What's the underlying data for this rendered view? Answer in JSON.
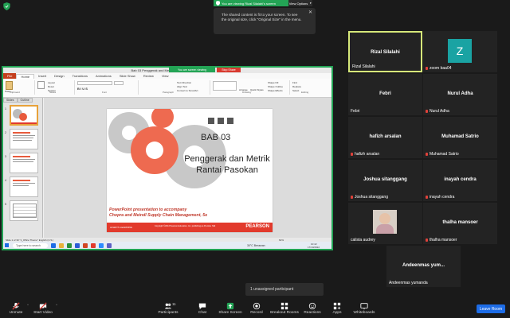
{
  "banner": {
    "text": "You are viewing Rizal Silalahi's screen",
    "view_options": "View Options"
  },
  "tooltip": {
    "text": "The shared content is fit to your screen. To see the original size, click \"Original Size\" in the menu."
  },
  "powerpoint": {
    "title": "Bab 03 Penggerak and Metrik Rantai Pasokan.pptx",
    "viewing": "You are screen viewing",
    "stop": "Stop Share",
    "tabs": [
      "File",
      "Home",
      "Insert",
      "Design",
      "Transitions",
      "Animations",
      "Slide Show",
      "Review",
      "View"
    ],
    "ribbon_groups": [
      "Clipboard",
      "Slides",
      "Font",
      "Paragraph",
      "Drawing",
      "Editing"
    ],
    "ribbon_items": [
      "Paste",
      "Layout",
      "Reset",
      "Section",
      "Find",
      "Replace",
      "Select",
      "Arrange",
      "Quick Styles",
      "Shape Fill",
      "Shape Outline",
      "Shape Effects",
      "Text Direction",
      "Align Text",
      "Convert to SmartArt"
    ],
    "panel_tabs": [
      "Slides",
      "Outline"
    ],
    "status_text": "Slide 1 of 30   \"1_Office Theme\"   English (U.S.)",
    "taskbar_search": "Type here to search",
    "weather": "30°C  Berawan",
    "clock": "10:42",
    "date": "17/10/2022",
    "zoom_level": "62%"
  },
  "slide": {
    "title": "BAB 03",
    "subtitle": "Penggerak dan Metrik Rantai Pasokan",
    "note_line1": "PowerPoint presentation to accompany",
    "note_line2": "Chopra and Meindl Supply Chain Management, 5e",
    "footer_left": "ALWAYS LEARNING",
    "footer_copy": "Copyright ©2013 Pearson Education, Inc. publishing as Prentice Hall",
    "publisher": "PEARSON"
  },
  "participants": [
    {
      "name": "Rizal Silalahi",
      "label": "Rizal Silalahi",
      "active": true,
      "muted": false
    },
    {
      "name": "Z",
      "label": "zoom baa04",
      "avatar_color": "#1aa3a3",
      "muted": true
    },
    {
      "name": "Febri",
      "label": "Febri",
      "muted": false
    },
    {
      "name": "Nurul Adha",
      "label": "Nurul Adha",
      "muted": true
    },
    {
      "name": "hafizh arsalan",
      "label": "hafizh arsalan",
      "muted": true
    },
    {
      "name": "Muhamad Satrio",
      "label": "Muhamad Satrio",
      "muted": true
    },
    {
      "name": "Joshua sitanggang",
      "label": "Joshua sitanggang",
      "muted": true
    },
    {
      "name": "inayah cendra",
      "label": "inayah cendra",
      "muted": true
    },
    {
      "name": "",
      "label": "calista audrey",
      "muted": false
    },
    {
      "name": "thalha mansoer",
      "label": "thalha mansoer",
      "muted": true
    },
    {
      "name": "Andeenmas yum...",
      "label": "Andeenmas yumanda",
      "muted": false
    }
  ],
  "unassigned": "1 unassigned participant",
  "toolbar": {
    "unmute": "Unmute",
    "start_video": "Start Video",
    "participants": "Participants",
    "participant_count": "11",
    "chat": "Chat",
    "share_screen": "Share Screen",
    "record": "Record",
    "breakout_rooms": "Breakout Rooms",
    "reactions": "Reactions",
    "apps": "Apps",
    "whiteboards": "Whiteboards",
    "leave": "Leave Room"
  },
  "colors": {
    "zoom_green": "#23a455",
    "leave_blue": "#1d6ce6",
    "muted_red": "#e0413a",
    "ppt_orange": "#c43e1c",
    "slide_red": "#e23a2c"
  }
}
